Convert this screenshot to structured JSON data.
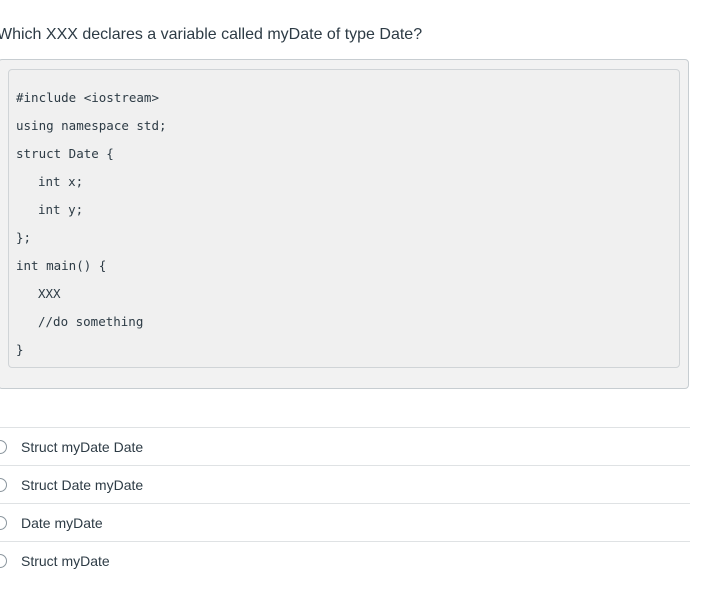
{
  "question": {
    "text": "Which XXX declares a variable called myDate of type Date?"
  },
  "code": {
    "lines": [
      "#include <iostream>",
      "using namespace std;",
      "struct Date {",
      "int x;",
      "int y;",
      "};",
      "int main() {",
      "XXX",
      "//do something",
      "}"
    ]
  },
  "answers": [
    {
      "label": "Struct myDate Date",
      "selected": false
    },
    {
      "label": "Struct Date myDate",
      "selected": false
    },
    {
      "label": "Date myDate",
      "selected": false
    },
    {
      "label": "Struct myDate",
      "selected": false
    }
  ]
}
